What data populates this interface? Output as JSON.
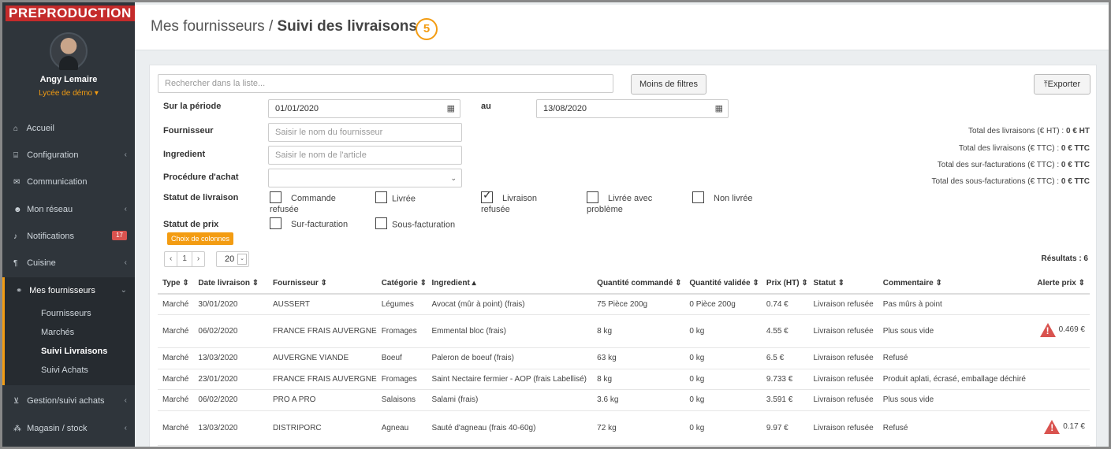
{
  "env": "PREPRODUCTION",
  "user": {
    "name": "Angy Lemaire",
    "school": "Lycée de démo ▾"
  },
  "nav": [
    {
      "icon": "home-icon",
      "glyph": "⌂",
      "label": "Accueil",
      "chevron": ""
    },
    {
      "icon": "bank-icon",
      "glyph": "⌸",
      "label": "Configuration",
      "chevron": "‹"
    },
    {
      "icon": "chat-icon",
      "glyph": "✉",
      "label": "Communication",
      "chevron": ""
    },
    {
      "icon": "users-icon",
      "glyph": "☻",
      "label": "Mon réseau",
      "chevron": "‹"
    },
    {
      "icon": "bell-icon",
      "glyph": "♪",
      "label": "Notifications",
      "badge": "17"
    },
    {
      "icon": "cutlery-icon",
      "glyph": "¶",
      "label": "Cuisine",
      "chevron": "‹"
    },
    {
      "icon": "handshake-icon",
      "glyph": "⚭",
      "label": "Mes fournisseurs",
      "chevron": "⌄"
    },
    {
      "icon": "cart-icon",
      "glyph": "⊻",
      "label": "Gestion/suivi achats",
      "chevron": "‹"
    },
    {
      "icon": "cubes-icon",
      "glyph": "⁂",
      "label": "Magasin / stock",
      "chevron": "‹"
    }
  ],
  "subnav": [
    "Fournisseurs",
    "Marchés",
    "Suivi Livraisons",
    "Suivi Achats"
  ],
  "header": {
    "title_prefix": "Mes fournisseurs / ",
    "title_main": "Suivi des livraisons",
    "step": "5"
  },
  "search": {
    "placeholder": "Rechercher dans la liste..."
  },
  "buttons": {
    "filters": "Moins de filtres",
    "export": "⤒Exporter",
    "columns": "Choix de colonnes"
  },
  "filters": {
    "period_label": "Sur la période",
    "period_from": "01/01/2020",
    "au_label": "au",
    "period_to": "13/08/2020",
    "supplier_label": "Fournisseur",
    "supplier_placeholder": "Saisir le nom du fournisseur",
    "ingredient_label": "Ingredient",
    "ingredient_placeholder": "Saisir le nom de l'article",
    "procedure_label": "Procédure d'achat",
    "procedure_value": "",
    "delivery_status_label": "Statut de livraison",
    "price_status_label": "Statut de prix"
  },
  "delivery_status": [
    {
      "label1": "Commande",
      "label2": "refusée",
      "checked": false
    },
    {
      "label1": "Livrée",
      "label2": "",
      "checked": false
    },
    {
      "label1": "Livraison",
      "label2": "refusée",
      "checked": true
    },
    {
      "label1": "Livrée avec",
      "label2": "problème",
      "checked": false
    },
    {
      "label1": "Non livrée",
      "label2": "",
      "checked": false
    }
  ],
  "price_status": [
    {
      "label": "Sur-facturation",
      "checked": false
    },
    {
      "label": "Sous-facturation",
      "checked": false
    }
  ],
  "totals": [
    {
      "label": "Total des livraisons (€ HT) : ",
      "value": "0 € HT"
    },
    {
      "label": "Total des livraisons (€ TTC) : ",
      "value": "0 € TTC"
    },
    {
      "label": "Total des sur-facturations (€ TTC) : ",
      "value": "0 € TTC"
    },
    {
      "label": "Total des sous-facturations (€ TTC) : ",
      "value": "0 € TTC"
    }
  ],
  "pager": {
    "prev": "‹",
    "page": "1",
    "next": "›",
    "per_page": "20",
    "results": "Résultats : 6"
  },
  "table": {
    "headers": [
      "Type ⇕",
      "Date livraison ⇕",
      "Fournisseur ⇕",
      "Catégorie ⇕",
      "Ingredient ▴",
      "Quantité commandé ⇕",
      "Quantité validée ⇕",
      "Prix (HT) ⇕",
      "Statut ⇕",
      "Commentaire ⇕",
      "Alerte prix ⇕"
    ],
    "rows": [
      {
        "h": 26,
        "cells": [
          "Marché",
          "30/01/2020",
          "AUSSERT",
          "Légumes",
          "Avocat (mûr à point) (frais)",
          "75 Pièce 200g",
          "0 Pièce 200g",
          "0.74 €",
          "Livraison refusée",
          "Pas mûrs à point",
          ""
        ]
      },
      {
        "h": 42,
        "cells": [
          "Marché",
          "06/02/2020",
          "FRANCE FRAIS AUVERGNE",
          "Fromages",
          "Emmental bloc (frais)",
          "8 kg",
          "0 kg",
          "4.55 €",
          "Livraison refusée",
          "Plus sous vide",
          "0.469 €"
        ]
      },
      {
        "h": 27,
        "cells": [
          "Marché",
          "13/03/2020",
          "AUVERGNE VIANDE",
          "Boeuf",
          "Paleron de boeuf (frais)",
          "63 kg",
          "0 kg",
          "6.5 €",
          "Livraison refusée",
          "Refusé",
          ""
        ]
      },
      {
        "h": 26,
        "cells": [
          "Marché",
          "23/01/2020",
          "FRANCE FRAIS AUVERGNE",
          "Fromages",
          "Saint Nectaire fermier - AOP (frais Labellisé)",
          "8 kg",
          "0 kg",
          "9.733 €",
          "Livraison refusée",
          "Produit aplati, écrasé, emballage déchiré",
          ""
        ]
      },
      {
        "h": 27,
        "cells": [
          "Marché",
          "06/02/2020",
          "PRO A PRO",
          "Salaisons",
          "Salami (frais)",
          "3.6 kg",
          "0 kg",
          "3.591 €",
          "Livraison refusée",
          "Plus sous vide",
          ""
        ]
      },
      {
        "h": 44,
        "cells": [
          "Marché",
          "13/03/2020",
          "DISTRIPORC",
          "Agneau",
          "Sauté d'agneau (frais 40-60g)",
          "72 kg",
          "0 kg",
          "9.97 €",
          "Livraison refusée",
          "Refusé",
          "0.17 €"
        ]
      }
    ]
  },
  "colors": {
    "accent": "#f39c12",
    "danger": "#d9534f",
    "sidebar": "#2f353b",
    "env": "#c42b2b"
  }
}
